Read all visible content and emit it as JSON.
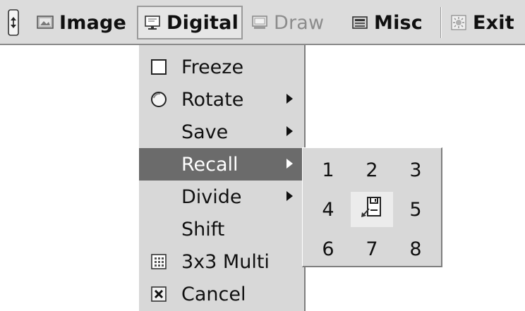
{
  "menubar": {
    "items": [
      {
        "label": "Image",
        "icon": "image-icon",
        "enabled": true
      },
      {
        "label": "Digital",
        "icon": "monitor-icon",
        "enabled": true,
        "open": true
      },
      {
        "label": "Draw",
        "icon": "draw-icon",
        "enabled": false
      },
      {
        "label": "Misc",
        "icon": "misc-icon",
        "enabled": true
      },
      {
        "label": "Exit",
        "icon": "exit-icon",
        "enabled": true
      }
    ]
  },
  "dropdown": {
    "items": [
      {
        "label": "Freeze",
        "icon": "checkbox-icon",
        "submenu": false
      },
      {
        "label": "Rotate",
        "icon": "circle-icon",
        "submenu": true
      },
      {
        "label": "Save",
        "submenu": true
      },
      {
        "label": "Recall",
        "submenu": true,
        "active": true
      },
      {
        "label": "Divide",
        "submenu": true
      },
      {
        "label": "Shift",
        "submenu": false
      },
      {
        "label": "3x3 Multi",
        "icon": "grid-icon",
        "submenu": false
      },
      {
        "label": "Cancel",
        "icon": "cancel-icon",
        "submenu": false
      }
    ]
  },
  "submenu": {
    "slots": [
      "1",
      "2",
      "3",
      "4",
      "",
      "5",
      "6",
      "7",
      "8"
    ],
    "center_icon": "floppy-load-icon"
  },
  "colors": {
    "menubar_bg": "#dcdcdc",
    "menu_bg": "#d8d8d8",
    "highlight_bg": "#6b6b6b",
    "disabled_text": "#8c8c8c"
  }
}
